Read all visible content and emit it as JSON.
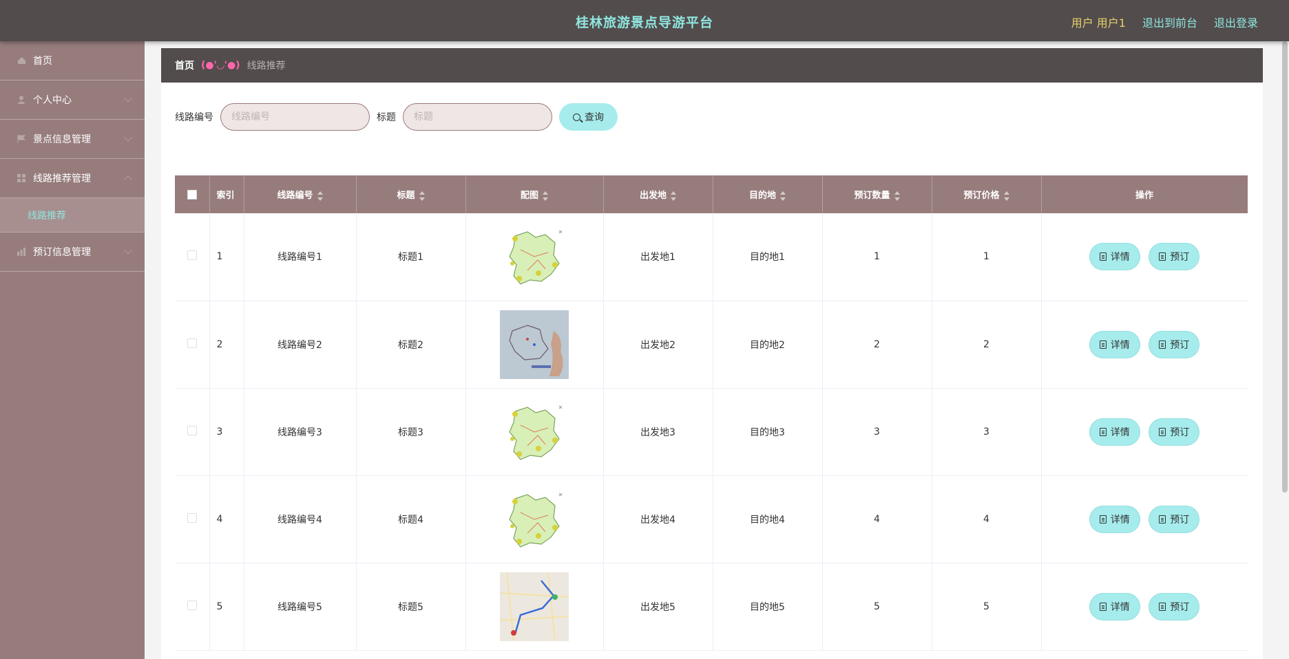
{
  "header": {
    "title": "桂林旅游景点导游平台",
    "user_label": "用户 用户1",
    "links": [
      "退出到前台",
      "退出登录"
    ]
  },
  "sidebar": {
    "items": [
      {
        "label": "首页",
        "icon": "home-icon"
      },
      {
        "label": "个人中心",
        "icon": "user-icon"
      },
      {
        "label": "景点信息管理",
        "icon": "flag-icon"
      },
      {
        "label": "线路推荐管理",
        "icon": "grid-icon"
      },
      {
        "label": "预订信息管理",
        "icon": "chart-icon"
      }
    ],
    "sub_item": "线路推荐"
  },
  "breadcrumb": {
    "home": "首页",
    "separator": "(●'◡'●)",
    "current": "线路推荐"
  },
  "search": {
    "route_label": "线路编号",
    "route_placeholder": "线路编号",
    "title_label": "标题",
    "title_placeholder": "标题",
    "button": "查询"
  },
  "table": {
    "headers": [
      "索引",
      "线路编号",
      "标题",
      "配图",
      "出发地",
      "目的地",
      "预订数量",
      "预订价格",
      "操作"
    ],
    "rows": [
      {
        "index": "1",
        "route": "线路编号1",
        "title": "标题1",
        "image": "map-green",
        "from": "出发地1",
        "to": "目的地1",
        "qty": "1",
        "price": "1"
      },
      {
        "index": "2",
        "route": "线路编号2",
        "title": "标题2",
        "image": "map-photo",
        "from": "出发地2",
        "to": "目的地2",
        "qty": "2",
        "price": "2"
      },
      {
        "index": "3",
        "route": "线路编号3",
        "title": "标题3",
        "image": "map-green",
        "from": "出发地3",
        "to": "目的地3",
        "qty": "3",
        "price": "3"
      },
      {
        "index": "4",
        "route": "线路编号4",
        "title": "标题4",
        "image": "map-green",
        "from": "出发地4",
        "to": "目的地4",
        "qty": "4",
        "price": "4"
      },
      {
        "index": "5",
        "route": "线路编号5",
        "title": "标题5",
        "image": "map-route",
        "from": "出发地5",
        "to": "目的地5",
        "qty": "5",
        "price": "5"
      }
    ],
    "detail_label": "详情",
    "book_label": "预订"
  },
  "colors": {
    "topbar": "#524c4c",
    "sidebar": "#977c7c",
    "accent": "#a6ecec",
    "title": "#8fe6df"
  }
}
